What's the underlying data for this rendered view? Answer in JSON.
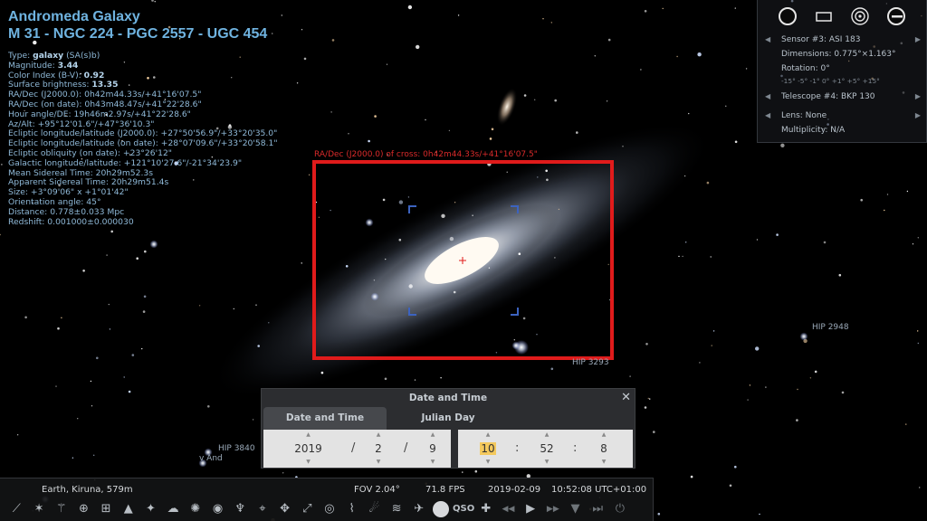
{
  "object": {
    "name": "Andromeda Galaxy",
    "designations": "M 31 - NGC 224 - PGC 2557 - UGC 454",
    "info": [
      {
        "label": "Type: ",
        "value": "galaxy",
        "extra": " (SA(s)b)"
      },
      {
        "label": "Magnitude: ",
        "value": "3.44",
        "extra": ""
      },
      {
        "label": "Color Index (B-V): ",
        "value": "0.92",
        "extra": ""
      },
      {
        "label": "Surface brightness: ",
        "value": "13.35",
        "extra": ""
      },
      {
        "label": "RA/Dec (J2000.0): 0h42m44.33s/+41°16'07.5\"",
        "value": "",
        "extra": ""
      },
      {
        "label": "RA/Dec (on date): 0h43m48.47s/+41°22'28.6\"",
        "value": "",
        "extra": ""
      },
      {
        "label": "Hour angle/DE: 19h46m2.97s/+41°22'28.6\"",
        "value": "",
        "extra": ""
      },
      {
        "label": "Az/Alt: +95°12'01.6\"/+47°36'10.3\"",
        "value": "",
        "extra": ""
      },
      {
        "label": "Ecliptic longitude/latitude (J2000.0): +27°50'56.9\"/+33°20'35.0\"",
        "value": "",
        "extra": ""
      },
      {
        "label": "Ecliptic longitude/latitude (on date): +28°07'09.6\"/+33°20'58.1\"",
        "value": "",
        "extra": ""
      },
      {
        "label": "Ecliptic obliquity (on date): +23°26'12\"",
        "value": "",
        "extra": ""
      },
      {
        "label": "Galactic longitude/latitude: +121°10'27.6\"/-21°34'23.9\"",
        "value": "",
        "extra": ""
      },
      {
        "label": "Mean Sidereal Time: 20h29m52.3s",
        "value": "",
        "extra": ""
      },
      {
        "label": "Apparent Sidereal Time: 20h29m51.4s",
        "value": "",
        "extra": ""
      },
      {
        "label": "Size: +3°09'06\" x +1°01'42\"",
        "value": "",
        "extra": ""
      },
      {
        "label": "Orientation angle: 45°",
        "value": "",
        "extra": ""
      },
      {
        "label": "Distance: 0.778±0.033 Mpc",
        "value": "",
        "extra": ""
      },
      {
        "label": "Redshift: 0.001000±0.000030",
        "value": "",
        "extra": ""
      }
    ]
  },
  "ocular": {
    "sensor": "Sensor #3: ASI 183",
    "dimensions": "Dimensions: 0.775°×1.163°",
    "rotation": "Rotation: 0°",
    "rotation_steps": "-15° -5° -1° 0° +1° +5° +15°",
    "telescope": "Telescope #4: BKP 130",
    "lens": "Lens: None",
    "multiplicity": "Multiplicity: N/A",
    "left_arrow": "◀",
    "right_arrow": "▶"
  },
  "sky_labels": {
    "cross": "RA/Dec (J2000.0) of cross:    0h42m44.33s/+41°16'07.5\"",
    "hip2948": "HIP 2948",
    "hip3293": "HIP 3293",
    "hip3840": "HIP 3840",
    "vand": "v And"
  },
  "dialog": {
    "title": "Date and Time",
    "close": "✕",
    "tab_active": "Date and Time",
    "tab_inactive": "Julian Day",
    "year": "2019",
    "month": "2",
    "day": "9",
    "hour": "10",
    "minute": "52",
    "second": "8",
    "date_sep": "/",
    "time_sep": ":",
    "spin_up": "▲",
    "spin_down": "▼"
  },
  "statusbar": {
    "location": "Earth, Kiruna, 579m",
    "fov": "FOV 2.04°",
    "fps": "71.8 FPS",
    "date": "2019-02-09",
    "time": "10:52:08 UTC+01:00"
  },
  "toolbar_icons": [
    "constellation-lines-icon",
    "constellation-labels-icon",
    "constellation-art-icon",
    "equatorial-grid-icon",
    "azimuthal-grid-icon",
    "ground-icon",
    "cardinal-points-icon",
    "atmosphere-icon",
    "nebulae-icon",
    "planets-labels-icon",
    "equatorial-mount-icon",
    "center-object-icon",
    "night-mode-icon",
    "fullscreen-icon",
    "ocular-icon",
    "meteor-icon",
    "satellites-icon",
    "exoplanets-icon",
    "bookmark-icon",
    "solar-system-icon",
    "qso-icon",
    "satellite-icon",
    "rewind-icon",
    "play-icon",
    "forward-icon",
    "now-icon",
    "fast-forward-icon",
    "quit-icon"
  ],
  "colors": {
    "frame": "#e01b1b",
    "highlight": "#f4c95d",
    "title": "#6fb3e0"
  }
}
